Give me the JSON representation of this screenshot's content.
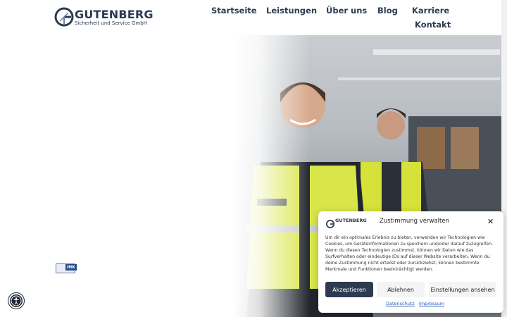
{
  "brand": {
    "name": "GUTENBERG",
    "tagline": "Sicherheit und Service GmbH",
    "color": "#2c3b52"
  },
  "nav": {
    "items": [
      "Startseite",
      "Leistungen",
      "Über uns",
      "Blog",
      "Karriere",
      "Kontakt"
    ]
  },
  "hero": {
    "image_description_icon": "security-staff-photo"
  },
  "badge": {
    "ihk_label": "IHK"
  },
  "consent": {
    "title": "Zustimmung verwalten",
    "body": "Um dir ein optimales Erlebnis zu bieten, verwenden wir Technologien wie Cookies, um Geräteinformationen zu speichern und/oder darauf zuzugreifen. Wenn du diesen Technologien zustimmst, können wir Daten wie das Surfverhalten oder eindeutige IDs auf dieser Website verarbeiten. Wenn du deine Zustimmung nicht erteilst oder zurückziehst, können bestimmte Merkmale und Funktionen beeinträchtigt werden.",
    "accept_label": "Akzeptieren",
    "deny_label": "Ablehnen",
    "prefs_label": "Einstellungen ansehen",
    "privacy_link": "Datenschutz",
    "imprint_link": "Impressum",
    "accent": "#2c3b52"
  }
}
